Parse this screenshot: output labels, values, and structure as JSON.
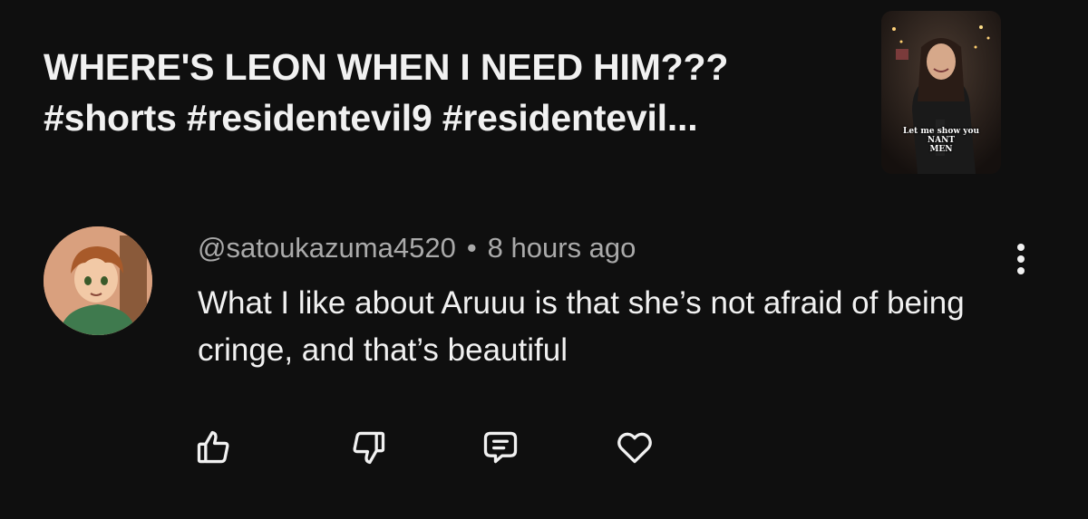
{
  "video": {
    "title_line1": "WHERE'S LEON WHEN I NEED HIM???",
    "title_line2": "#shorts #residentevil9 #residentevil...",
    "thumbnail": {
      "caption_line1": "Let me show you",
      "caption_line2": "NANT",
      "caption_line3": "MEN"
    }
  },
  "comment": {
    "author": "@satoukazuma4520",
    "separator": "•",
    "time": "8 hours ago",
    "text": "What I like about Aruuu is that she’s not afraid of being cringe, and that’s beautiful"
  },
  "actions": {
    "icons": [
      "thumbs-up-icon",
      "thumbs-down-icon",
      "reply-icon",
      "heart-icon"
    ]
  },
  "colors": {
    "background": "#0f0f0f",
    "primary_text": "#f1f1f1",
    "secondary_text": "#aaaaaa"
  }
}
